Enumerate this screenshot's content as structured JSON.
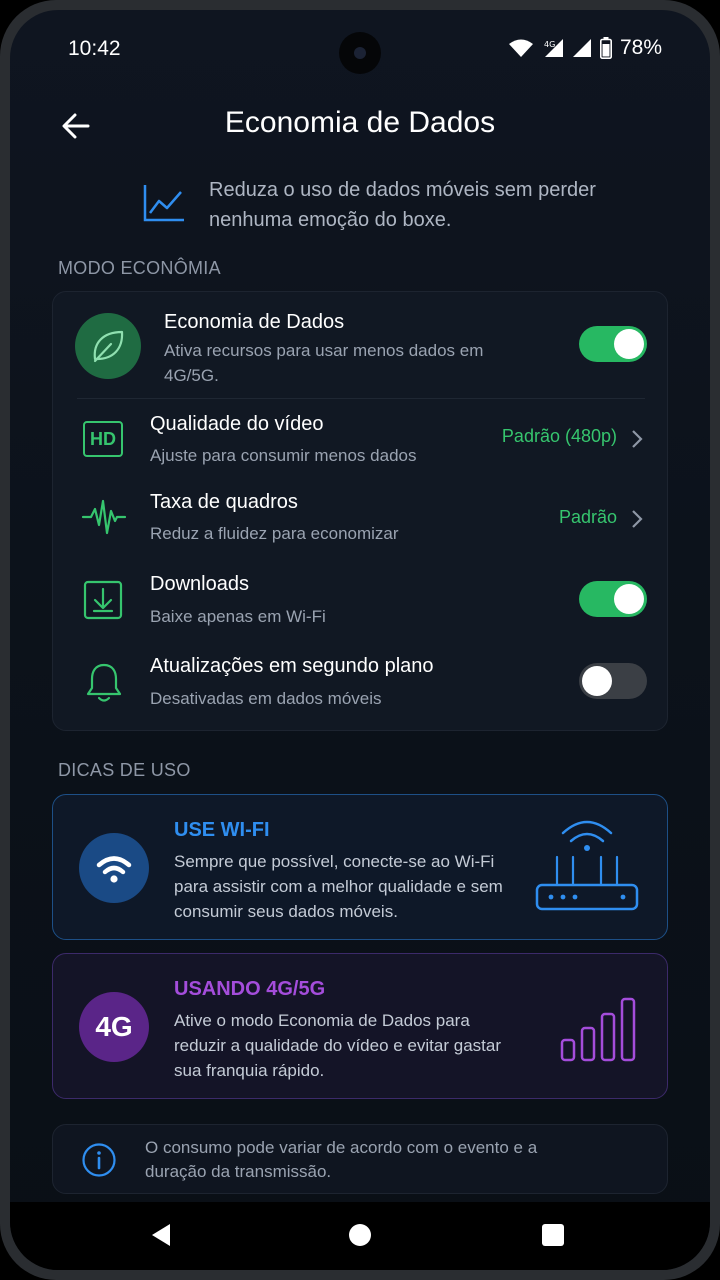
{
  "status": {
    "time": "10:42",
    "battery": "78%",
    "network": "4G"
  },
  "header": {
    "title": "Economia de Dados"
  },
  "intro": {
    "text": "Reduza o uso de dados móveis sem perder nenhuma emoção do boxe."
  },
  "section_mode": {
    "label": "MODO ECONÔMIA"
  },
  "settings": {
    "saver": {
      "title": "Economia de Dados",
      "desc": "Ativa recursos para usar menos dados em 4G/5G.",
      "enabled": true
    },
    "video": {
      "title": "Qualidade do vídeo",
      "desc": "Ajuste para consumir menos dados",
      "value": "Padrão (480p)",
      "icon_text": "HD"
    },
    "framerate": {
      "title": "Taxa de quadros",
      "desc": "Reduz a fluidez para economizar",
      "value": "Padrão"
    },
    "downloads": {
      "title": "Downloads",
      "desc": "Baixe apenas em Wi-Fi",
      "enabled": true
    },
    "background": {
      "title": "Atualizações em segundo plano",
      "desc": "Desativadas em dados móveis",
      "enabled": false
    }
  },
  "section_tips": {
    "label": "DICAS DE USO"
  },
  "tips": {
    "wifi": {
      "title": "USE WI-FI",
      "text": "Sempre que possível, conecte-se ao Wi-Fi para assistir com a melhor qualidade e sem consumir seus dados móveis.",
      "color": "#2f8ef0"
    },
    "mobile": {
      "title": "USANDO 4G/5G",
      "badge": "4G",
      "text": "Ative o modo Economia de Dados para reduzir a qualidade do vídeo e evitar gastar sua franquia rápido.",
      "color": "#a44ddb"
    }
  },
  "note": {
    "text": "O consumo pode variar de acordo com o evento e a duração da transmissão."
  },
  "colors": {
    "accent_green": "#27b862",
    "accent_blue": "#2f8ef0",
    "accent_purple": "#a44ddb"
  }
}
